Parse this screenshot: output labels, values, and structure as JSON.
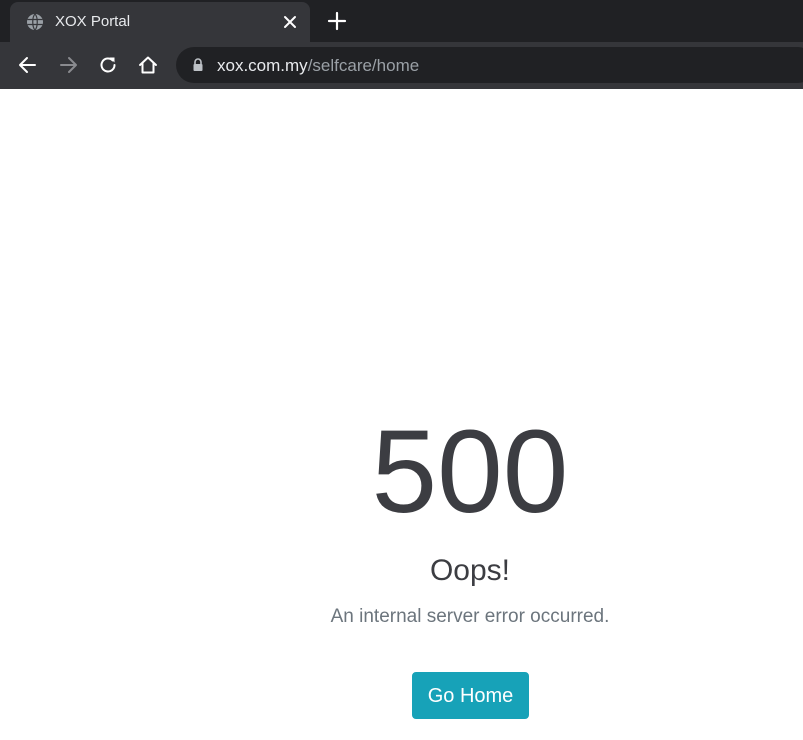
{
  "browser": {
    "tab": {
      "title": "XOX Portal",
      "favicon": "globe-icon"
    },
    "toolbar": {
      "back_icon": "back-arrow-icon",
      "forward_icon": "forward-arrow-icon",
      "reload_icon": "reload-icon",
      "home_icon": "home-icon"
    },
    "address_bar": {
      "host": "xox.com.my",
      "path": "/selfcare/home",
      "security_icon": "lock-icon"
    }
  },
  "page": {
    "error_code": "500",
    "title": "Oops!",
    "message": "An internal server error occurred.",
    "button_label": "Go Home",
    "button_color": "#17a2b8"
  }
}
